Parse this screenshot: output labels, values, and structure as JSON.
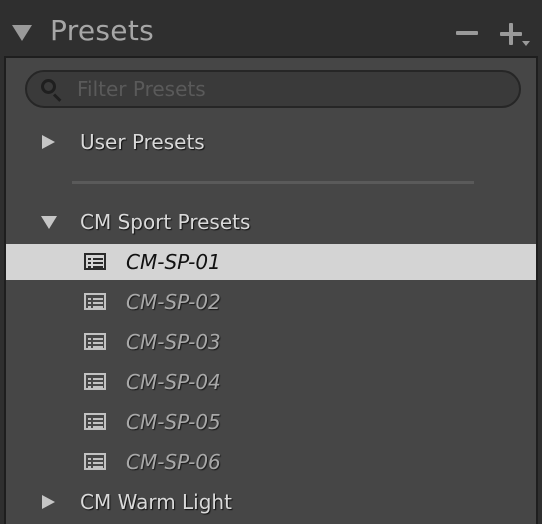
{
  "header": {
    "title": "Presets",
    "remove_icon": "minus-icon",
    "add_icon": "plus-dropdown-icon"
  },
  "filter": {
    "placeholder": "Filter Presets",
    "value": "",
    "icon": "search-icon"
  },
  "folders": {
    "user_presets": {
      "label": "User Presets",
      "expanded": false
    },
    "cm_sport": {
      "label": "CM Sport Presets",
      "expanded": true,
      "presets": [
        {
          "label": "CM-SP-01",
          "selected": true
        },
        {
          "label": "CM-SP-02",
          "selected": false
        },
        {
          "label": "CM-SP-03",
          "selected": false
        },
        {
          "label": "CM-SP-04",
          "selected": false
        },
        {
          "label": "CM-SP-05",
          "selected": false
        },
        {
          "label": "CM-SP-06",
          "selected": false
        }
      ]
    },
    "cm_warm": {
      "label": "CM Warm Light",
      "expanded": false
    }
  },
  "colors": {
    "panel_bg": "#2f2f2f",
    "list_bg": "#464646",
    "selected_bg": "#d4d4d4",
    "text": "#d9d9d9",
    "preset_text": "#a8a8a8"
  }
}
